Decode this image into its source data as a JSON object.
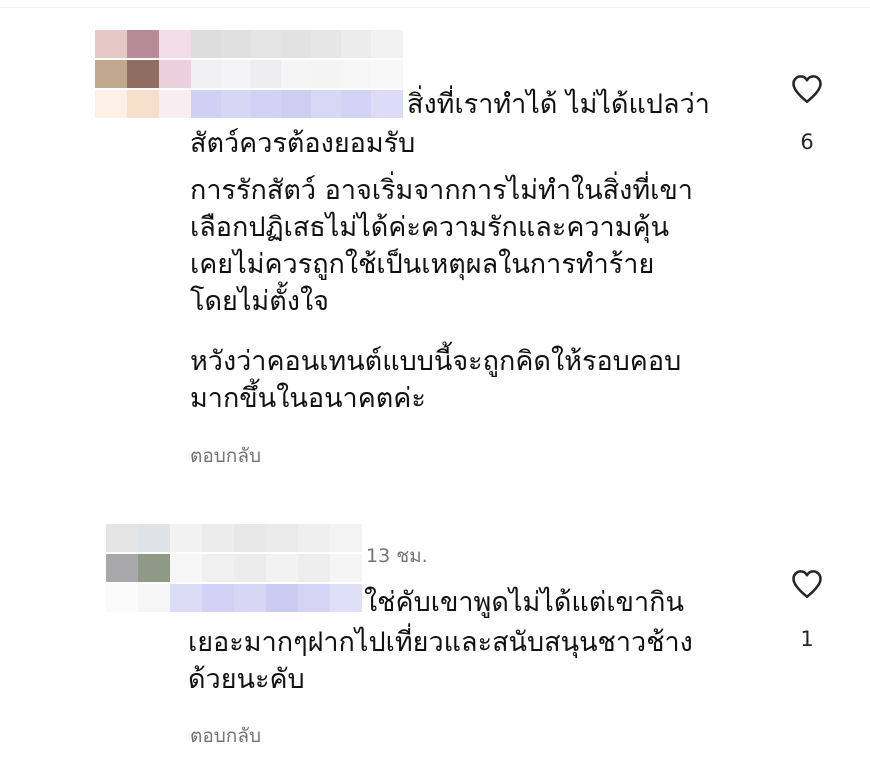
{
  "comments": [
    {
      "first_line": "สิ่งที่เราทำได้ ไม่ได้แปลว่า",
      "paragraphs": [
        "สัตว์ควรต้องยอมรับ",
        "การรักสัตว์ อาจเริ่มจากการไม่ทำในสิ่งที่เขา\nเลือกปฏิเสธไม่ได้ค่ะความรักและความคุ้น\nเคยไม่ควรถูกใช้เป็นเหตุผลในการทำร้าย\nโดยไม่ตั้งใจ",
        "หวังว่าคอนเทนต์แบบนี้จะถูกคิดให้รอบคอบ\nมากขึ้นในอนาคตค่ะ"
      ],
      "reply_label": "ตอบกลับ",
      "like_count": "6",
      "like_icon": "heart-outline-icon"
    },
    {
      "time": "13 ชม.",
      "first_line": "ใช่คับเขาพูดไม่ได้แต่เขากิน",
      "paragraphs": [
        "เยอะมากๆฝากไปเที่ยวและสนับสนุนชาวช้าง\nด้วยนะคับ"
      ],
      "reply_label": "ตอบกลับ",
      "like_count": "1",
      "like_icon": "heart-outline-icon"
    }
  ]
}
